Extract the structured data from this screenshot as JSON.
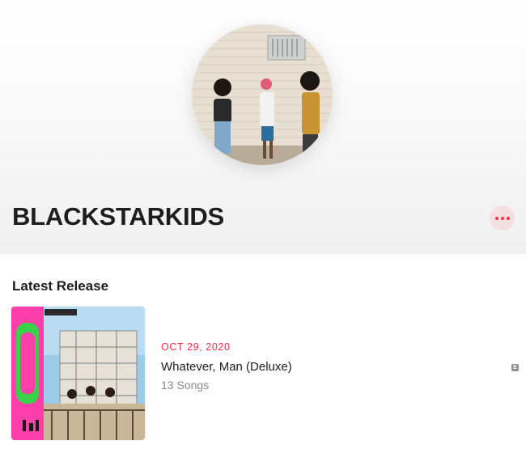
{
  "artist": {
    "name": "BLACKSTARKIDS",
    "avatar_alt": "BLACKSTARKIDS"
  },
  "actions": {
    "more_icon": "ellipsis-icon",
    "accent_color": "#fa2d48"
  },
  "latest_release": {
    "section_title": "Latest Release",
    "date": "OCT 29, 2020",
    "title": "Whatever, Man (Deluxe)",
    "song_count": "13 Songs",
    "explicit": "E"
  }
}
